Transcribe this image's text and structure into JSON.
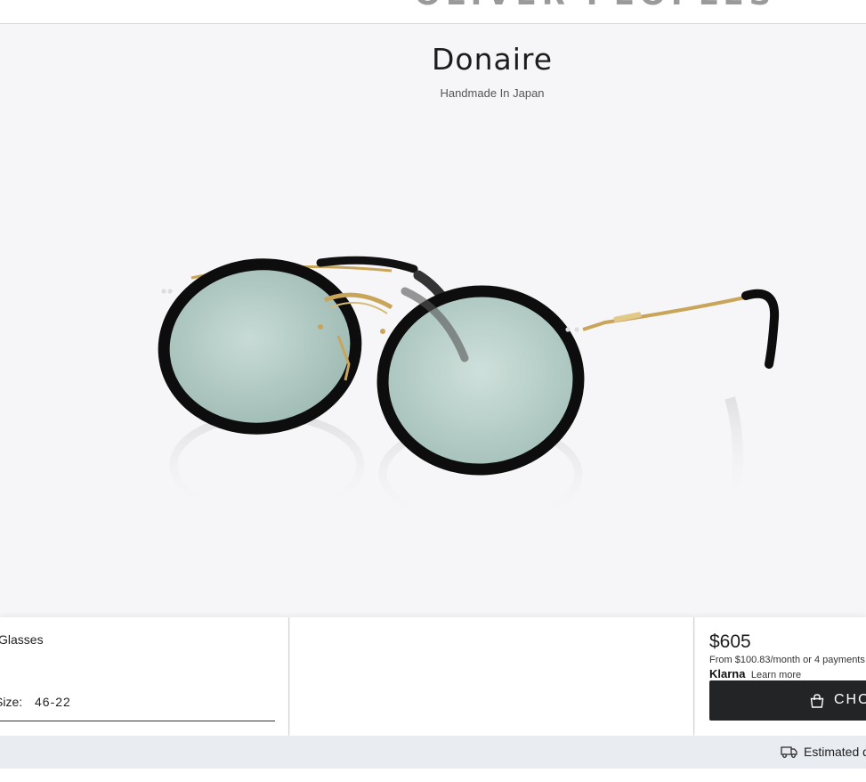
{
  "header": {
    "logo_text": "OLIVER PEOPLES"
  },
  "product": {
    "name": "Donaire",
    "tagline": "Handmade In Japan"
  },
  "options": {
    "lens_type": "Glasses",
    "size_label": "Size:",
    "size_value": "46-22"
  },
  "purchase": {
    "price": "$605",
    "installments": "From $100.83/month or 4 payments",
    "klarna_label": "Klarna",
    "learn_more": "Learn more",
    "choose_label": "CHOOSE LENSES"
  },
  "delivery": {
    "text": "Estimated delivery"
  },
  "colors": {
    "stage_bg": "#f6f6f8",
    "button_bg": "#222426",
    "delivery_bg": "#e9edf2",
    "lens_tint": "#9fbfb6",
    "frame": "#111111",
    "metal": "#c9a55a"
  },
  "icons": [
    "bag-icon",
    "truck-icon"
  ]
}
